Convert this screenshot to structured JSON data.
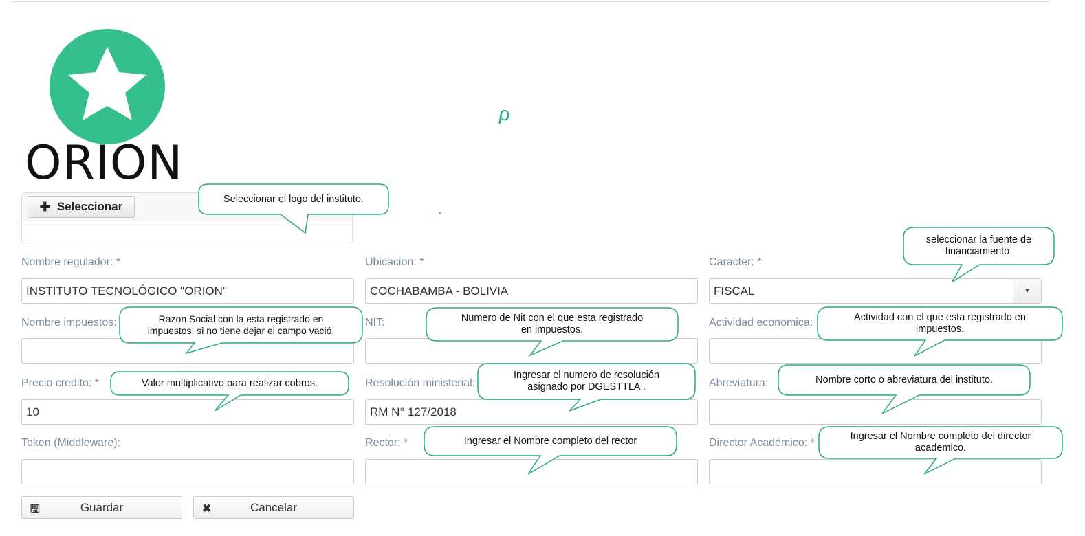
{
  "logo": {
    "text": "ORION",
    "icon": "star-icon",
    "color": "#35c08b"
  },
  "upload": {
    "button_label": "Seleccionar",
    "icon": "plus-icon"
  },
  "form": {
    "nombre_regulador": {
      "label": "Nombre regulador: *",
      "value": "INSTITUTO TECNOLÓGICO  \"ORION\""
    },
    "ubicacion": {
      "label": "Ubicacion: *",
      "value": "COCHABAMBA - BOLIVIA"
    },
    "caracter": {
      "label": "Caracter: *",
      "value": "FISCAL"
    },
    "nombre_impuestos": {
      "label": "Nombre impuestos:",
      "value": ""
    },
    "nit": {
      "label": "NIT:",
      "value": ""
    },
    "actividad_economica": {
      "label": "Actividad economica:",
      "value": ""
    },
    "precio_credito": {
      "label": "Precio credito: *",
      "value": "10"
    },
    "resolucion_ministerial": {
      "label": "Resolución ministerial:",
      "value": "RM N° 127/2018"
    },
    "abreviatura": {
      "label": "Abreviatura:",
      "value": ""
    },
    "token": {
      "label": "Token (Middleware):",
      "value": ""
    },
    "rector": {
      "label": "Rector: *",
      "value": ""
    },
    "director_academico": {
      "label": "Director Académico: *",
      "value": ""
    }
  },
  "buttons": {
    "save": "Guardar",
    "cancel": "Cancelar"
  },
  "callouts": {
    "logo": "Seleccionar el logo del instituto.",
    "caracter_1": "seleccionar la fuente de",
    "caracter_2": "financiamiento.",
    "nombre_impuestos_1": "Razon  Social con la esta registrado en",
    "nombre_impuestos_2": "impuestos, si no tiene dejar el campo vació.",
    "nit_1": "Numero de Nit con el que esta registrado",
    "nit_2": "en impuestos.",
    "actividad_1": "Actividad con el que esta registrado en",
    "actividad_2": "impuestos.",
    "precio": "Valor multiplicativo para realizar cobros.",
    "resolucion_1": "Ingresar el numero de resolución",
    "resolucion_2": "asignado por DGESTTLA  .",
    "abreviatura": "Nombre corto o abreviatura del instituto.",
    "rector": "Ingresar el Nombre completo  del rector",
    "director_1": "Ingresar el Nombre completo  del director",
    "director_2": "academico."
  },
  "theme": {
    "callout_border": "#2aa889",
    "label_color": "#7c8b9c"
  }
}
